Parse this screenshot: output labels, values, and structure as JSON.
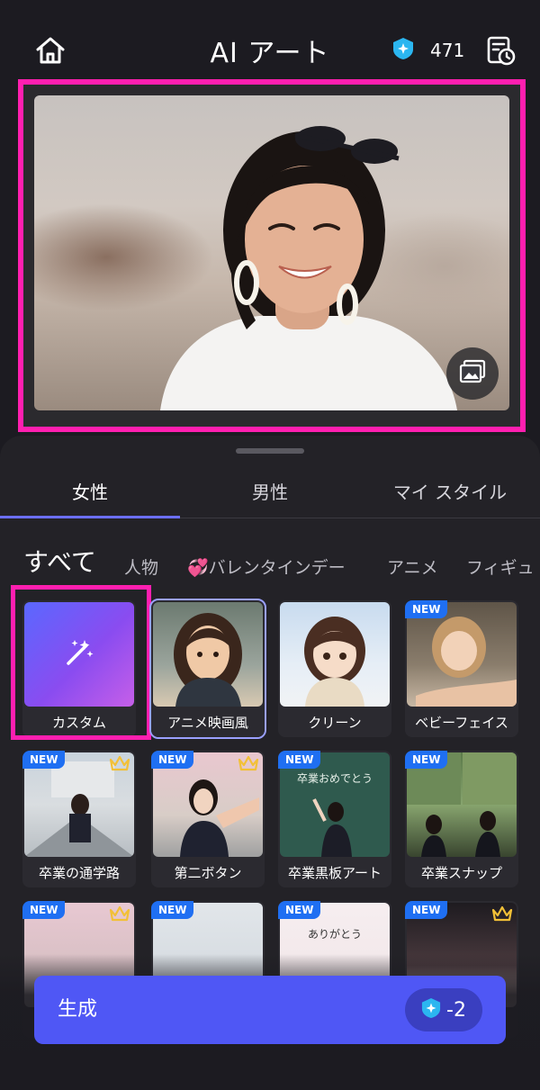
{
  "header": {
    "title": "AI アート",
    "credits": "471",
    "icons": [
      "home-icon",
      "gem-icon",
      "history-icon"
    ]
  },
  "photo": {
    "gallery_icon": "gallery-icon"
  },
  "tabs": [
    {
      "label": "女性",
      "active": true
    },
    {
      "label": "男性",
      "active": false
    },
    {
      "label": "マイ スタイル",
      "active": false
    }
  ],
  "categories": [
    {
      "label": "すべて",
      "active": true
    },
    {
      "label": "人物"
    },
    {
      "label": "💞バレンタインデー"
    },
    {
      "label": "アニメ"
    },
    {
      "label": "フィギュ"
    }
  ],
  "styles": [
    {
      "label": "カスタム",
      "new": false,
      "premium": false
    },
    {
      "label": "アニメ映画風",
      "new": false,
      "premium": false
    },
    {
      "label": "クリーン",
      "new": false,
      "premium": false
    },
    {
      "label": "ベビーフェイス",
      "new": true,
      "premium": false
    },
    {
      "label": "卒業の通学路",
      "new": true,
      "premium": true
    },
    {
      "label": "第二ボタン",
      "new": true,
      "premium": true
    },
    {
      "label": "卒業黒板アート",
      "new": true,
      "premium": false
    },
    {
      "label": "卒業スナップ",
      "new": true,
      "premium": false
    },
    {
      "label": "",
      "new": true,
      "premium": true
    },
    {
      "label": "",
      "new": true,
      "premium": false
    },
    {
      "label": "",
      "new": true,
      "premium": false
    },
    {
      "label": "",
      "new": true,
      "premium": true
    }
  ],
  "badges": {
    "new": "NEW"
  },
  "tile_text": {
    "chalkboard": "卒業おめでとう",
    "letter": "ありがとう"
  },
  "generate": {
    "label": "生成",
    "cost": "-2"
  },
  "colors": {
    "background": "#1c1b21",
    "sheet": "#232227",
    "accent": "#4f57f5",
    "highlight": "#ff1fb0",
    "badge": "#1f6ff2"
  }
}
